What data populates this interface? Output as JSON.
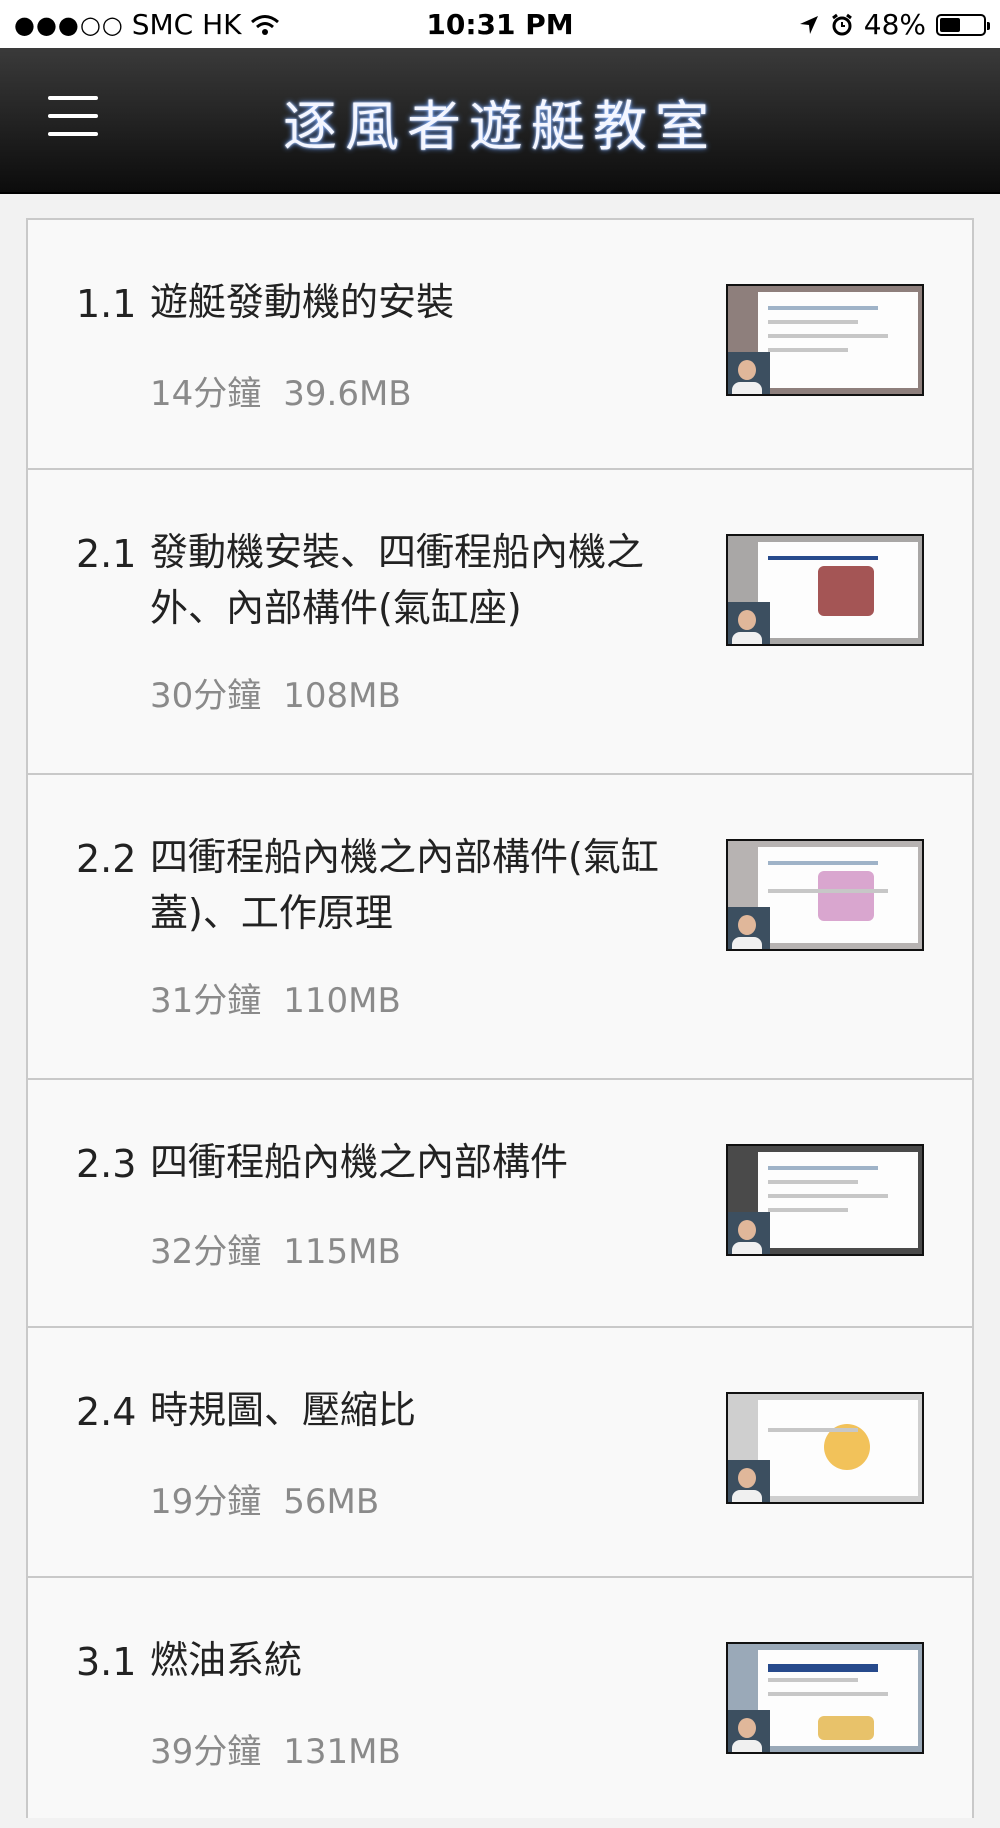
{
  "status_bar": {
    "signal": "●●●○○",
    "carrier": "SMC HK",
    "time": "10:31 PM",
    "battery_percent": "48%",
    "battery_level": 0.48
  },
  "header": {
    "title": "逐風者遊艇教室",
    "menu_icon": "hamburger-menu-icon"
  },
  "colors": {
    "header_bg": "#1a1a1a",
    "title_glow": "#6aa0ff",
    "meta_text": "#8a8a8a"
  },
  "lessons": [
    {
      "number": "1.1",
      "title": "遊艇發動機的安裝",
      "duration": "14分鐘",
      "size": "39.6MB"
    },
    {
      "number": "2.1",
      "title": "發動機安裝、四衝程船內機之外、內部構件(氣缸座)",
      "duration": "30分鐘",
      "size": "108MB"
    },
    {
      "number": "2.2",
      "title": "四衝程船內機之內部構件(氣缸蓋)、工作原理",
      "duration": "31分鐘",
      "size": "110MB"
    },
    {
      "number": "2.3",
      "title": "四衝程船內機之內部構件",
      "duration": "32分鐘",
      "size": "115MB"
    },
    {
      "number": "2.4",
      "title": "時規圖、壓縮比",
      "duration": "19分鐘",
      "size": "56MB"
    },
    {
      "number": "3.1",
      "title": "燃油系統",
      "duration": "39分鐘",
      "size": "131MB"
    }
  ]
}
